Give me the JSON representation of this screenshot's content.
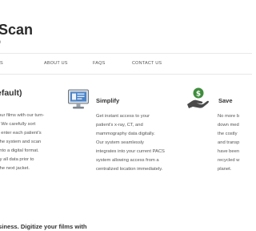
{
  "site": {
    "title": "Scan",
    "tagline": "e"
  },
  "nav": {
    "items": [
      {
        "label": "S"
      },
      {
        "label": "ABOUT US"
      },
      {
        "label": "FAQS"
      },
      {
        "label": "CONTACT US"
      }
    ]
  },
  "main": {
    "heading": "efault)",
    "columns": [
      {
        "title": "",
        "icon": "",
        "lines": [
          "our films with our turn-",
          ". We carefully sort",
          ", enter each patient's",
          " the system and scan",
          " into a digital format.",
          "fy all data prior to",
          " the next jacket."
        ]
      },
      {
        "title": "Simplify",
        "icon": "computer-monitor-icon",
        "lines": [
          "Get instant access to your",
          "patient's x-ray, CT, and",
          "mammography data digitally.",
          " Our system seamlessly",
          "integrates into your current PACS",
          "system allowing access from a",
          "centralized location immediately."
        ]
      },
      {
        "title": "Save",
        "icon": "hand-holding-money-icon",
        "lines": [
          "No more b",
          "down med",
          "the costly",
          "and transp",
          "have been",
          "recycled w",
          "planet."
        ]
      }
    ],
    "bottom_heading": "siness. Digitize your films with"
  },
  "colors": {
    "money_green": "#3f8d3c",
    "monitor_blue": "#4b84c8"
  }
}
